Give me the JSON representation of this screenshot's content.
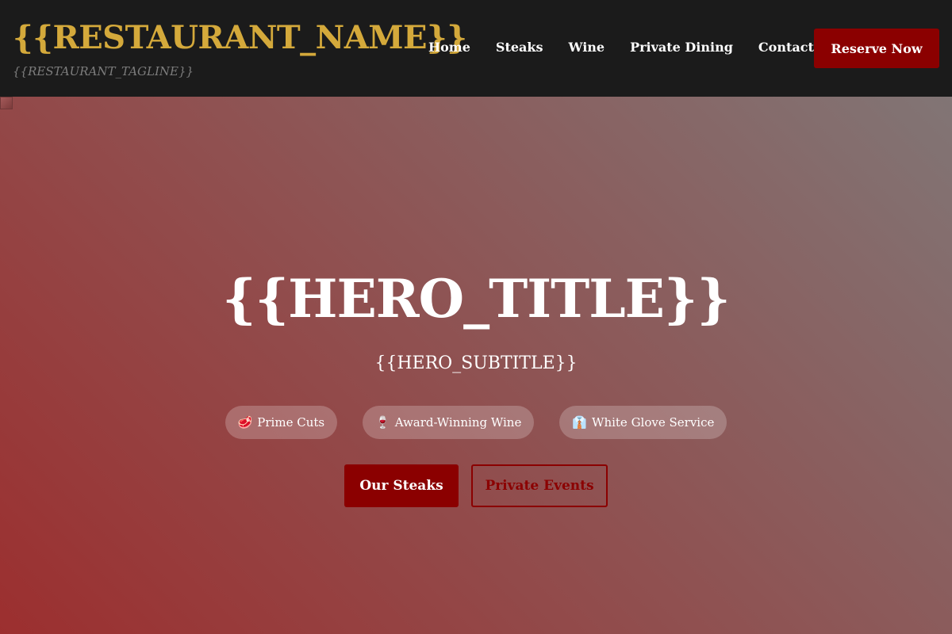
{
  "header": {
    "restaurant_name": "{{RESTAURANT_NAME}}",
    "tagline": "{{RESTAURANT_TAGLINE}}",
    "nav": [
      {
        "label": "Home"
      },
      {
        "label": "Steaks"
      },
      {
        "label": "Wine"
      },
      {
        "label": "Private Dining"
      },
      {
        "label": "Contact"
      }
    ],
    "reserve_label": "Reserve Now"
  },
  "hero": {
    "title": "{{HERO_TITLE}}",
    "subtitle": "{{HERO_SUBTITLE}}",
    "badges": [
      {
        "icon": "🥩",
        "icon_name": "steak-icon",
        "label": "Prime Cuts"
      },
      {
        "icon": "🍷",
        "icon_name": "wine-glass-icon",
        "label": "Award-Winning Wine"
      },
      {
        "icon": "👔",
        "icon_name": "shirt-tie-icon",
        "label": "White Glove Service"
      }
    ],
    "primary_cta": "Our Steaks",
    "secondary_cta": "Private Events"
  },
  "colors": {
    "header_bg": "#1b1b1b",
    "brand_gold": "#d4a93b",
    "accent_red": "#8b0000",
    "tagline_gray": "#7d7d7d"
  }
}
